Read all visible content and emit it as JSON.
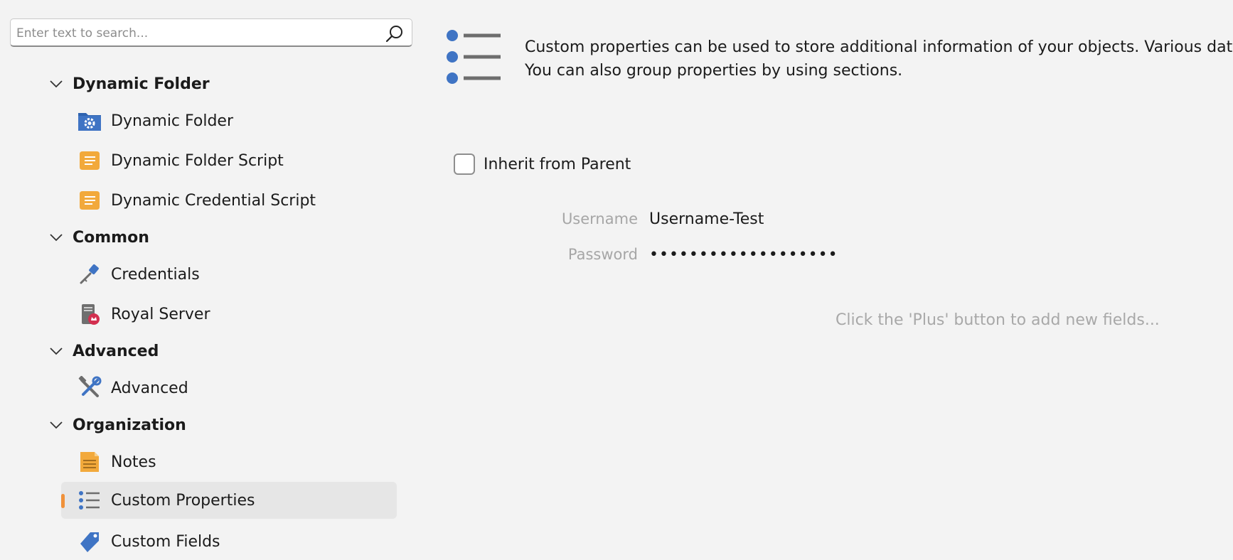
{
  "search": {
    "placeholder": "Enter text to search..."
  },
  "icons": {
    "search": "search-icon",
    "chevron": "chevron-down-icon",
    "dynamic_folder": "folder-gear-icon",
    "script": "script-scroll-icon",
    "credentials": "key-icon",
    "royal_server": "server-icon",
    "advanced": "tools-icon",
    "notes": "notes-icon",
    "custom_properties": "list-icon",
    "custom_fields": "tag-icon"
  },
  "colors": {
    "accent": "#f0913a",
    "blue": "#3f74c4",
    "orange": "#f2a93b",
    "selected_bg": "#e6e6e6"
  },
  "sidebar": {
    "groups": [
      {
        "title": "Dynamic Folder",
        "items": [
          "Dynamic Folder",
          "Dynamic Folder Script",
          "Dynamic Credential Script"
        ]
      },
      {
        "title": "Common",
        "items": [
          "Credentials",
          "Royal Server"
        ]
      },
      {
        "title": "Advanced",
        "items": [
          "Advanced"
        ]
      },
      {
        "title": "Organization",
        "items": [
          "Notes",
          "Custom Properties",
          "Custom Fields"
        ]
      }
    ],
    "selected": "Custom Properties"
  },
  "content": {
    "description_line1": "Custom properties can be used to store additional information of your objects. Various data fo",
    "description_line2": "You can also group properties by using sections.",
    "inherit_label": "Inherit from Parent",
    "inherit_checked": false,
    "fields": [
      {
        "label": "Username",
        "value": "Username-Test"
      },
      {
        "label": "Password",
        "value": "•••••••••••••••••••"
      }
    ],
    "hint": "Click the 'Plus' button to add new fields..."
  }
}
